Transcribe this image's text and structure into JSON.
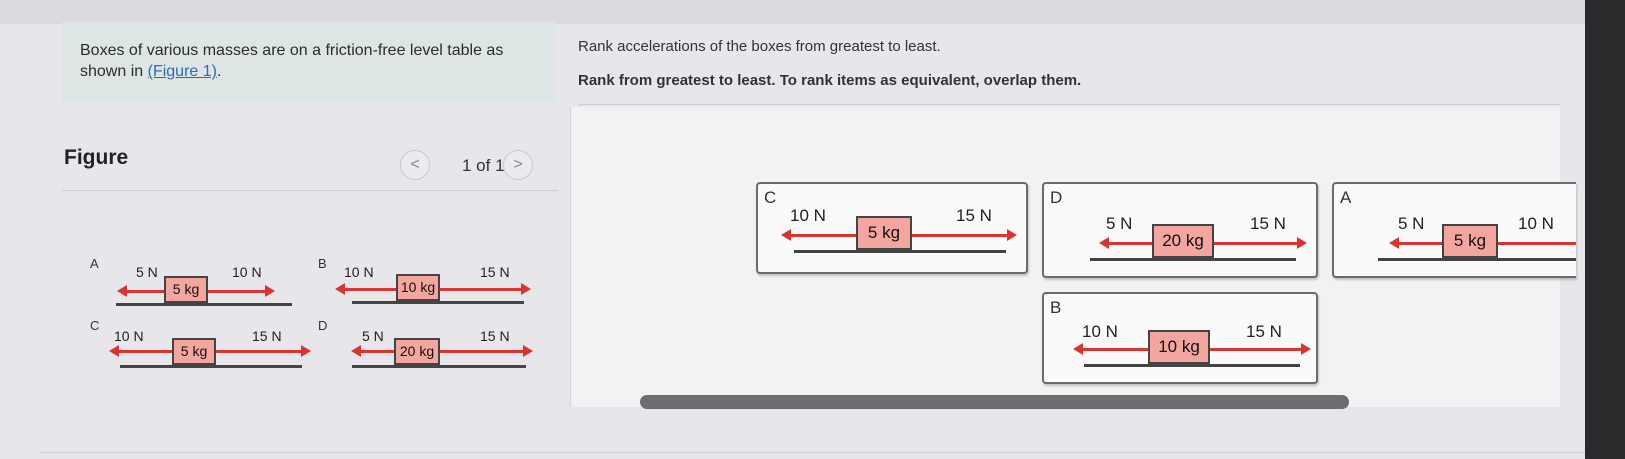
{
  "problem": {
    "prompt_text": "Boxes of various masses are on a friction-free level table as shown in",
    "prompt_link": "(Figure 1)",
    "prompt_end": "."
  },
  "figure": {
    "title": "Figure",
    "counter": "1 of 1",
    "prev_glyph": "<",
    "next_glyph": ">",
    "items": [
      {
        "label": "A",
        "left_force": "5 N",
        "mass": "5 kg",
        "right_force": "10 N"
      },
      {
        "label": "B",
        "left_force": "10 N",
        "mass": "10 kg",
        "right_force": "15 N"
      },
      {
        "label": "C",
        "left_force": "10 N",
        "mass": "5 kg",
        "right_force": "15 N"
      },
      {
        "label": "D",
        "left_force": "5 N",
        "mass": "20 kg",
        "right_force": "15 N"
      }
    ]
  },
  "question": {
    "text": "Rank accelerations of the boxes from greatest to least.",
    "instruction": "Rank from greatest to least. To rank items as equivalent, overlap them."
  },
  "ranking_cards": [
    {
      "label": "C",
      "left_force": "10 N",
      "mass": "5 kg",
      "right_force": "15 N"
    },
    {
      "label": "D",
      "left_force": "5 N",
      "mass": "20 kg",
      "right_force": "15 N"
    },
    {
      "label": "A",
      "left_force": "5 N",
      "mass": "5 kg",
      "right_force": "10 N"
    },
    {
      "label": "B",
      "left_force": "10 N",
      "mass": "10 kg",
      "right_force": "15 N"
    }
  ],
  "colors": {
    "accent_link": "#2f6bb3",
    "arrow": "#d9342f",
    "box_fill": "#f3a5a0",
    "prompt_bg": "#dde5e5"
  }
}
